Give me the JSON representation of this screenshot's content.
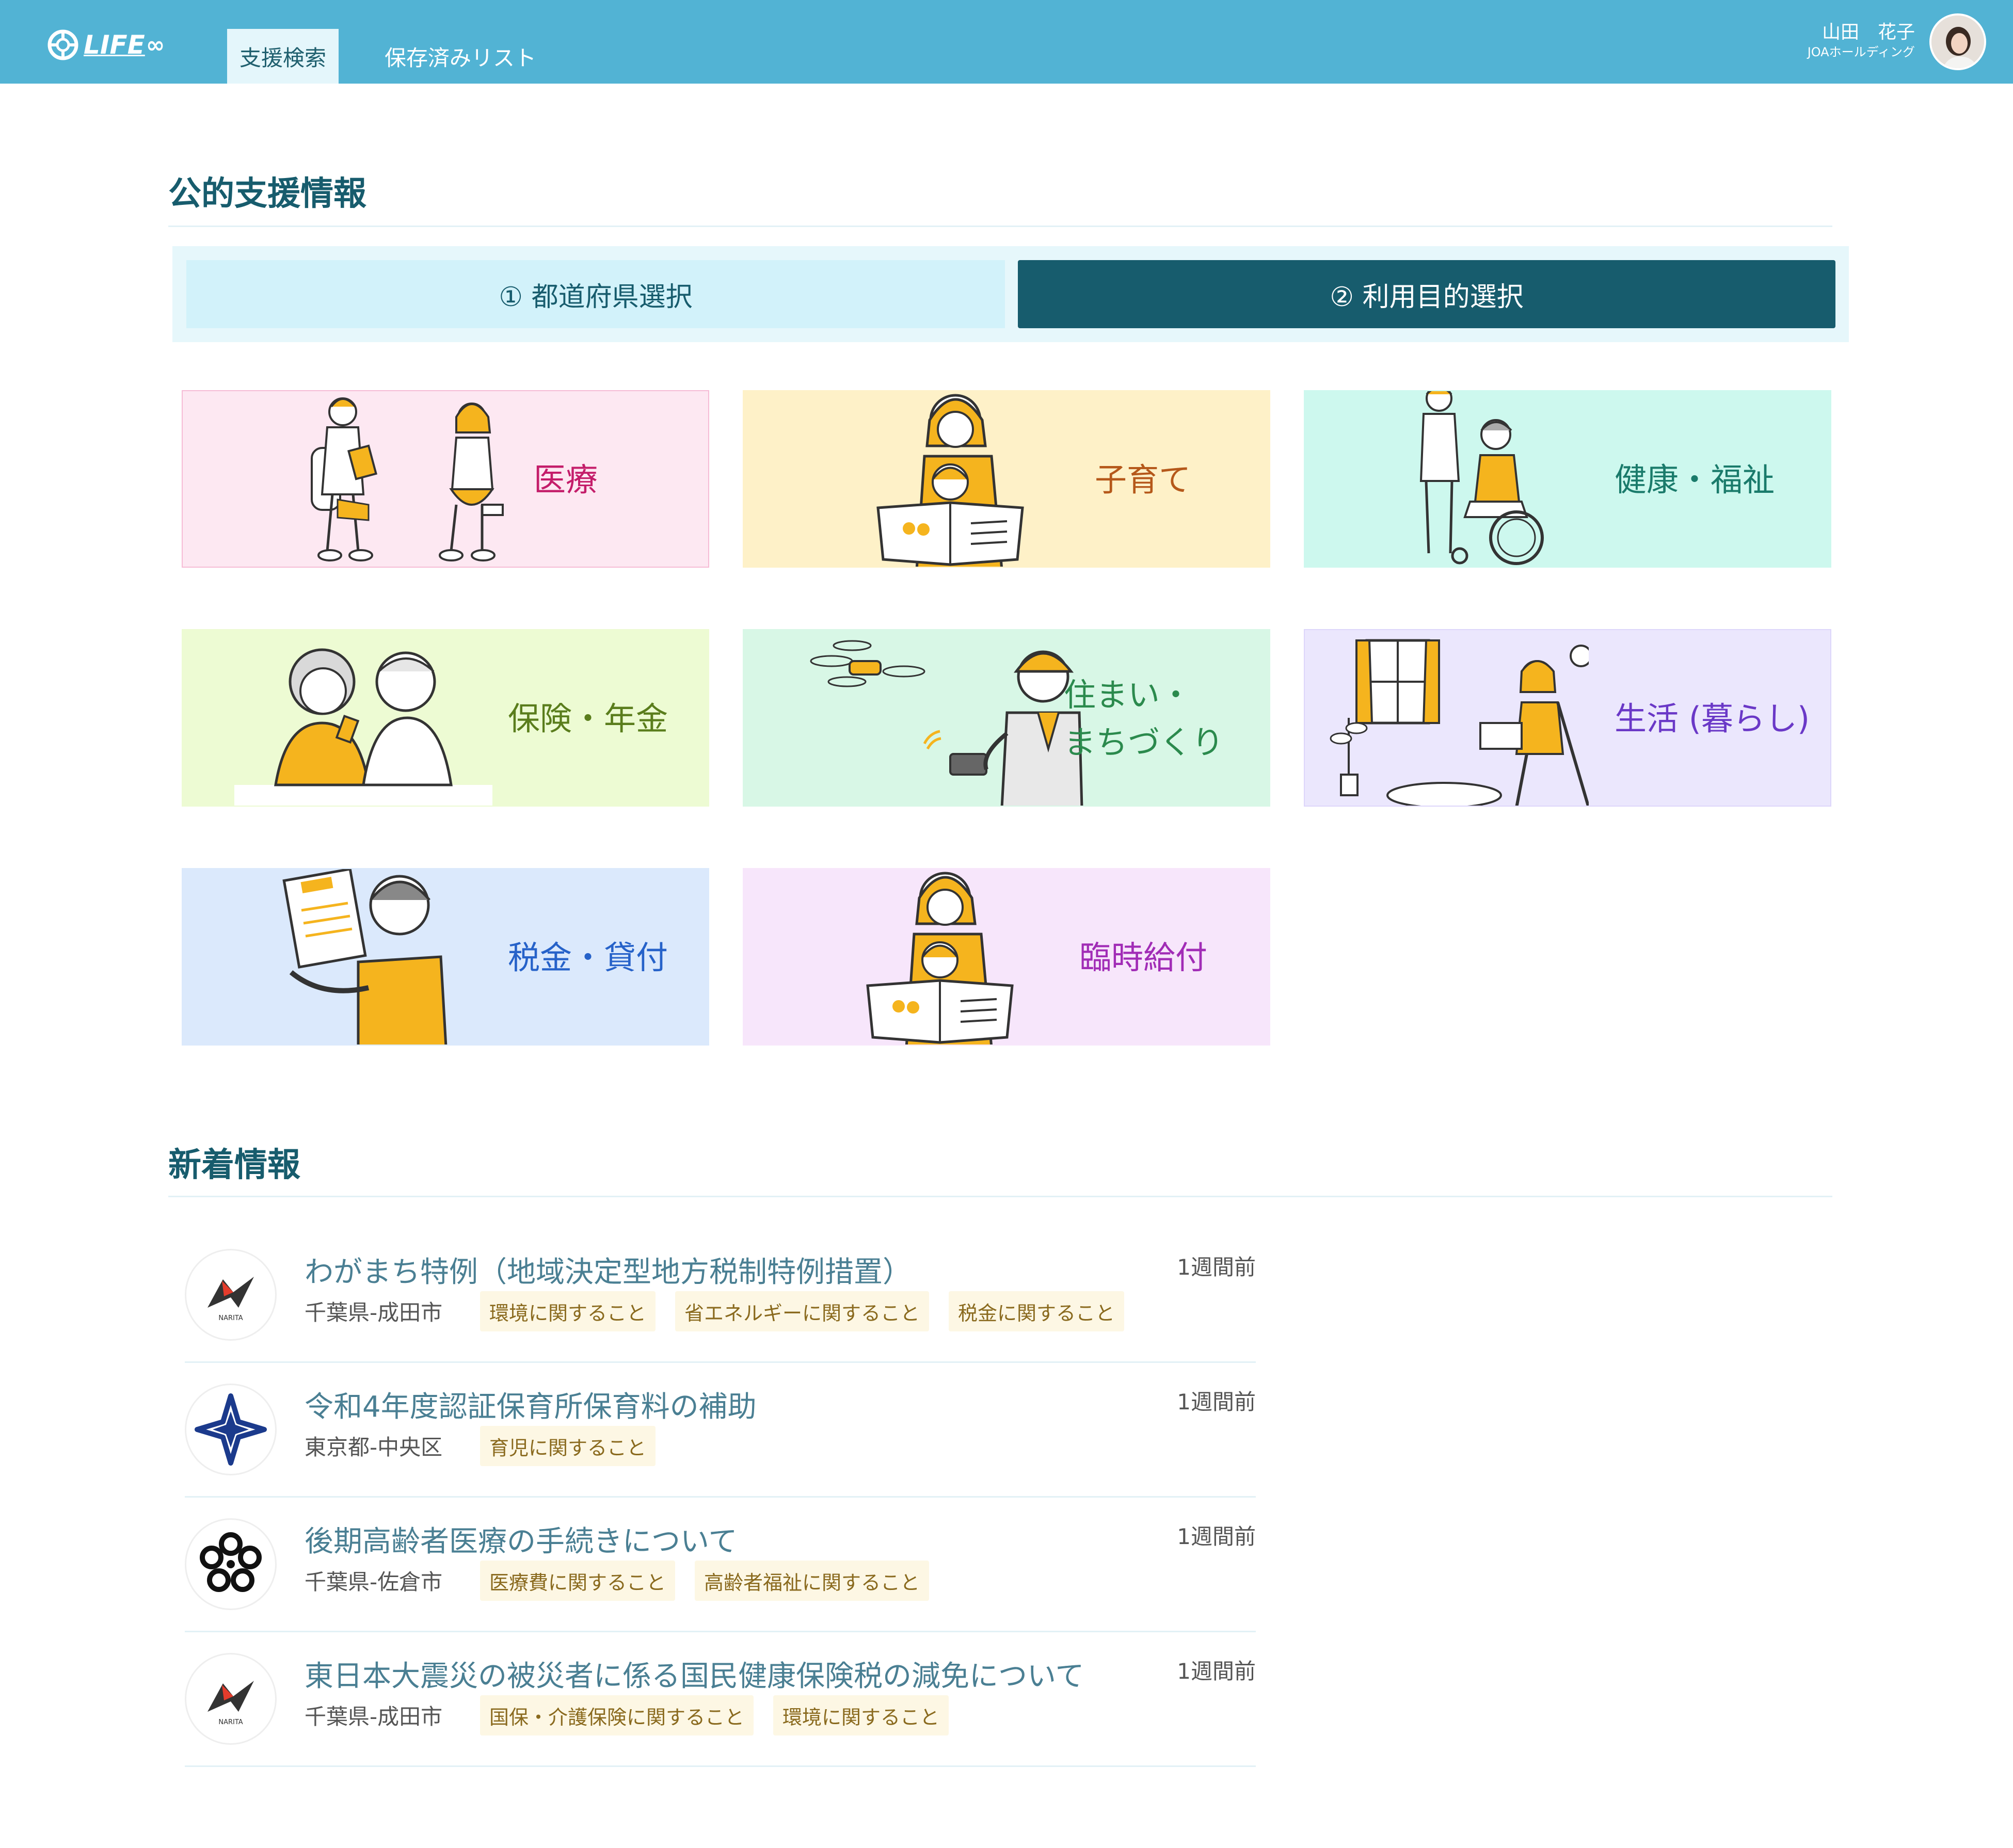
{
  "header": {
    "logo_text": "LIFE",
    "logo_suffix": "∞",
    "tabs": [
      {
        "label": "支援検索",
        "active": true
      },
      {
        "label": "保存済みリスト",
        "active": false
      }
    ],
    "user": {
      "name": "山田　花子",
      "org": "JOAホールディング"
    }
  },
  "public_support": {
    "title": "公的支援情報",
    "steps": [
      {
        "label": "① 都道府県選択"
      },
      {
        "label": "② 利用目的選択"
      }
    ],
    "categories": [
      {
        "label": "医療",
        "bg": "#fde8f2",
        "border": "#f6bcd6",
        "color": "#c41d6a",
        "illustration": "doctor-patient-icon"
      },
      {
        "label": "子育て",
        "bg": "#fef1c8",
        "border": "#fef1c8",
        "color": "#b5581a",
        "illustration": "mother-child-reading-icon"
      },
      {
        "label": "健康・福祉",
        "bg": "#cdf8ee",
        "border": "#cdf8ee",
        "color": "#1a7b6b",
        "illustration": "caregiver-wheelchair-icon"
      },
      {
        "label": "保険・年金",
        "bg": "#edfbd3",
        "border": "#edfbd3",
        "color": "#5a7d1c",
        "illustration": "elderly-couple-icon"
      },
      {
        "label": "住まい・\nまちづくり",
        "bg": "#d8f7e6",
        "border": "#d8f7e6",
        "color": "#2b8a4d",
        "illustration": "worker-drone-icon"
      },
      {
        "label": "生活 (暮らし)",
        "bg": "#ebe7fd",
        "border": "#ddd6fb",
        "color": "#6a38c7",
        "illustration": "woman-laptop-icon"
      },
      {
        "label": "税金・貸付",
        "bg": "#dbe9fc",
        "border": "#dbe9fc",
        "color": "#2662c9",
        "illustration": "man-tax-document-icon"
      },
      {
        "label": "臨時給付",
        "bg": "#f7e6fb",
        "border": "#f7e6fb",
        "color": "#a12cb6",
        "illustration": "mother-child-reading-icon"
      }
    ]
  },
  "news": {
    "title": "新着情報",
    "items": [
      {
        "title": "わがまち特例（地域決定型地方税制特例措置）",
        "location": "千葉県-成田市",
        "time": "1週間前",
        "tags": [
          "環境に関すること",
          "省エネルギーに関すること",
          "税金に関すること"
        ],
        "logo": "narita-emblem-icon",
        "logo_text": "NARITA"
      },
      {
        "title": "令和4年度認証保育所保育料の補助",
        "location": "東京都-中央区",
        "time": "1週間前",
        "tags": [
          "育児に関すること"
        ],
        "logo": "chuo-emblem-icon"
      },
      {
        "title": "後期高齢者医療の手続きについて",
        "location": "千葉県-佐倉市",
        "time": "1週間前",
        "tags": [
          "医療費に関すること",
          "高齢者福祉に関すること"
        ],
        "logo": "sakura-emblem-icon"
      },
      {
        "title": "東日本大震災の被災者に係る国民健康保険税の減免について",
        "location": "千葉県-成田市",
        "time": "1週間前",
        "tags": [
          "国保・介護保険に関すること",
          "環境に関すること"
        ],
        "logo": "narita-emblem-icon",
        "logo_text": "NARITA"
      }
    ]
  },
  "colors": {
    "header": "#52b3d4",
    "accent": "#175c6d",
    "tag_bg": "#fdf7e4",
    "tag_text": "#8a6a1e"
  }
}
